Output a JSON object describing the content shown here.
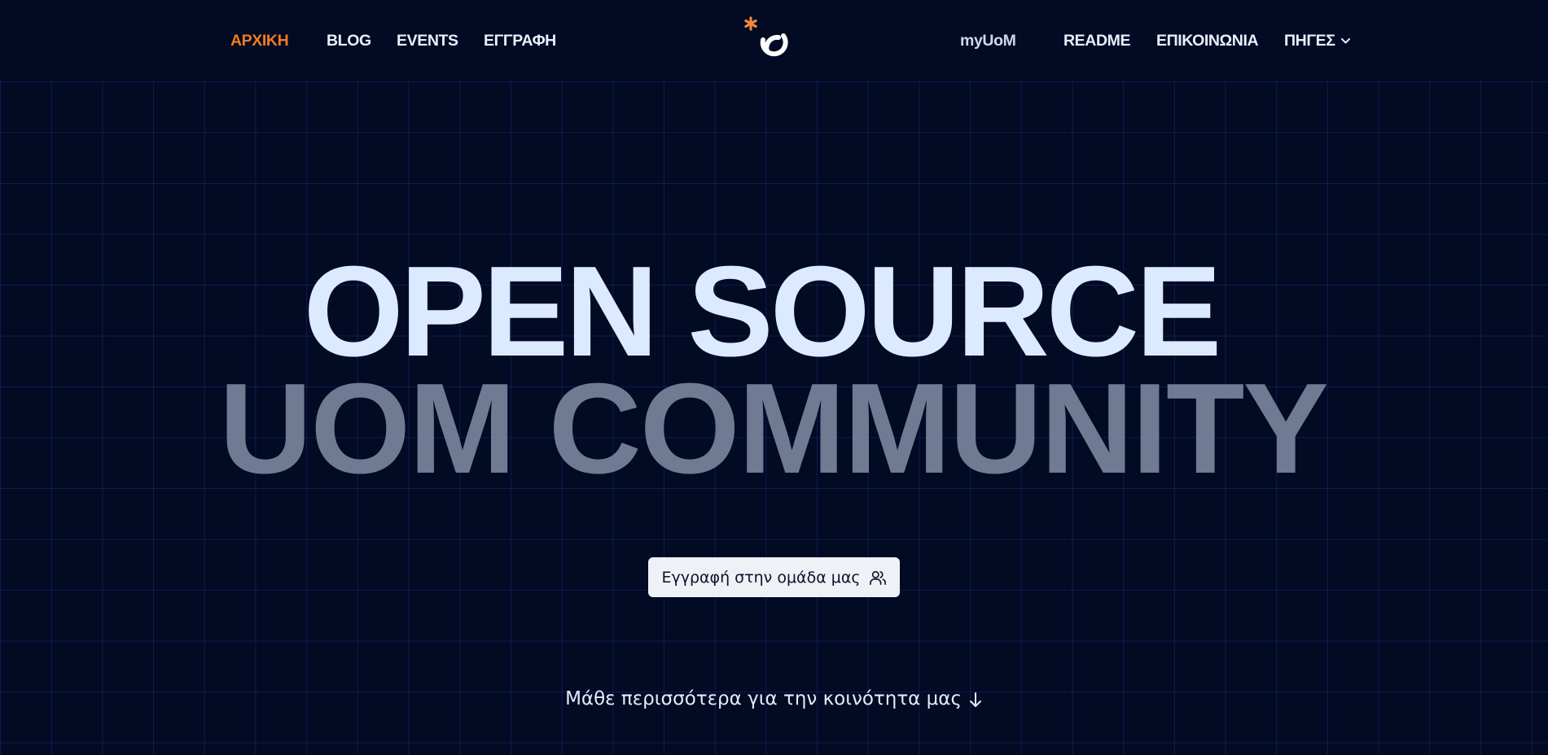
{
  "nav": {
    "left": [
      {
        "label": "ΑΡΧΙΚΗ",
        "active": true
      },
      {
        "label": "BLOG"
      },
      {
        "label": "EVENTS"
      },
      {
        "label": "ΕΓΓΡΑΦΗ"
      }
    ],
    "right": [
      {
        "label": "myUoM"
      },
      {
        "label": "README"
      },
      {
        "label": "ΕΠΙΚΟΙΝΩΝΙΑ"
      },
      {
        "label": "ΠΗΓΕΣ",
        "icon": "chevron-down-icon"
      }
    ],
    "logo_icon": "asterisk-loop-logo"
  },
  "hero": {
    "line1": "OPEN SOURCE",
    "line2": "UOM COMMUNITY",
    "cta_label": "Εγγραφή στην ομάδα μας",
    "cta_icon": "users-icon",
    "learn_more": "Μάθε περισσότερα για την κοινότητα μας",
    "learn_more_icon": "arrow-down-icon"
  },
  "colors": {
    "background": "#020a24",
    "accent": "#f27b1f",
    "hero_primary": "#dceaff",
    "hero_secondary": "#6f7a93",
    "grid": "#2337a0"
  }
}
